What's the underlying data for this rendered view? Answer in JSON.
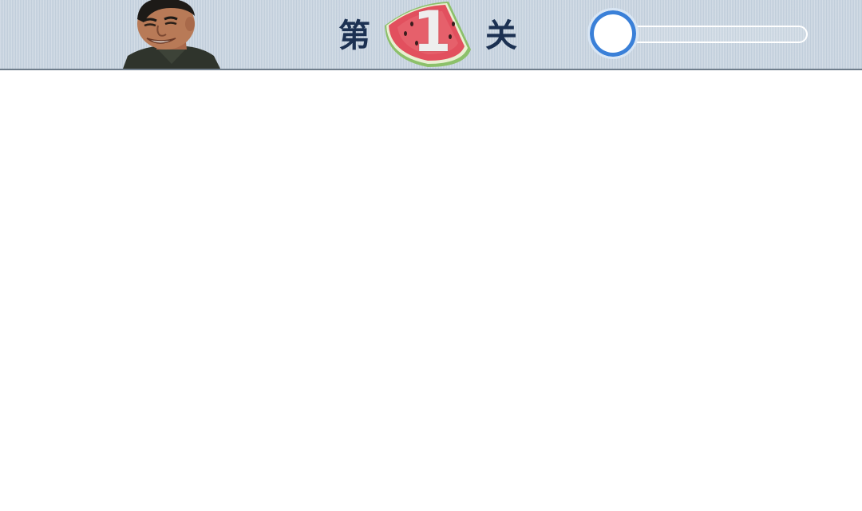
{
  "header": {
    "avatar_icon": "smiling-man-portrait-icon",
    "level_prefix": "第",
    "level_number": "1",
    "level_suffix": "关",
    "level_badge_icon": "watermelon-slice-icon",
    "colors": {
      "bar_background": "#c9d5e1",
      "title_text": "#1c3152",
      "progress_accent": "#3a80d8",
      "watermelon_flesh": "#e2505e",
      "watermelon_rind": "#8cc06a"
    }
  },
  "progress": {
    "value_percent": 0
  }
}
